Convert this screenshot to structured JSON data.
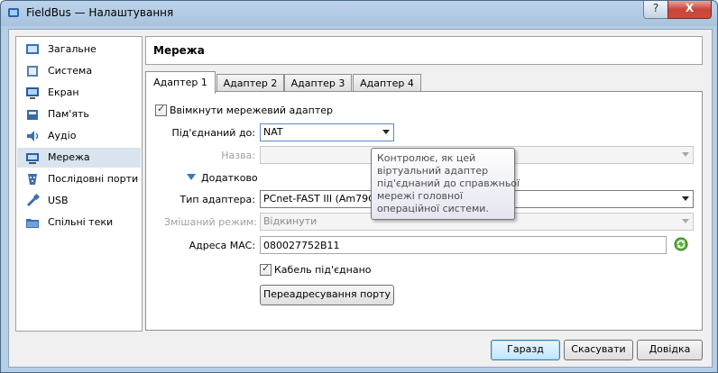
{
  "window": {
    "title": "FieldBus — Налаштування",
    "help_btn": "?",
    "close_btn": "X"
  },
  "sidebar": {
    "items": [
      {
        "label": "Загальне",
        "icon": "general-icon"
      },
      {
        "label": "Система",
        "icon": "system-icon"
      },
      {
        "label": "Екран",
        "icon": "display-icon"
      },
      {
        "label": "Пам'ять",
        "icon": "storage-icon"
      },
      {
        "label": "Аудіо",
        "icon": "audio-icon"
      },
      {
        "label": "Мережа",
        "icon": "network-icon",
        "selected": true
      },
      {
        "label": "Послідовні порти",
        "icon": "serial-ports-icon"
      },
      {
        "label": "USB",
        "icon": "usb-icon"
      },
      {
        "label": "Спільні теки",
        "icon": "shared-folders-icon"
      }
    ]
  },
  "header": {
    "title": "Мережа"
  },
  "tabs": [
    {
      "label": "Адаптер 1",
      "active": true
    },
    {
      "label": "Адаптер 2"
    },
    {
      "label": "Адаптер 3"
    },
    {
      "label": "Адаптер 4"
    }
  ],
  "form": {
    "enable_adapter": "Ввімкнути мережевий адаптер",
    "attached_to_label": "Під'єднаний до:",
    "attached_to_value": "NAT",
    "name_label": "Назва:",
    "name_value": "",
    "advanced_label": "Додатково",
    "adapter_type_label": "Тип адаптера:",
    "adapter_type_value": "PCnet-FAST III (Am79C973)",
    "promisc_label": "Змішаний режим:",
    "promisc_value": "Відкинути",
    "mac_label": "Адреса MAC:",
    "mac_value": "080027752B11",
    "cable_label": "Кабель під'єднано",
    "port_forwarding_btn": "Переадресування порту"
  },
  "tooltip": {
    "lines": [
      "Контролює, як цей",
      "віртуальний адаптер",
      "під'єднаний до справжньої",
      "мережі головної",
      "операційної системи."
    ]
  },
  "buttons": {
    "ok": "Гаразд",
    "cancel": "Скасувати",
    "help": "Довідка"
  }
}
